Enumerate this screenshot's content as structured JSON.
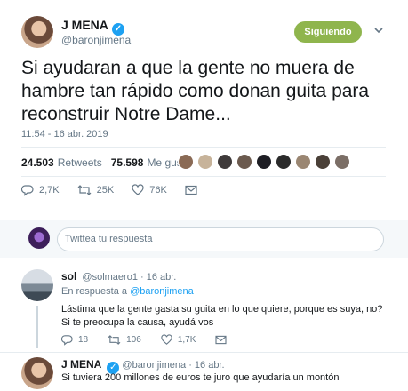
{
  "tweet": {
    "author_name": "J MENA",
    "author_handle": "@baronjimena",
    "follow_label": "Siguiendo",
    "text": "Si ayudaran a que la gente no muera de hambre tan rápido como donan guita para reconstruir Notre Dame...",
    "timestamp": "11:54 - 16 abr. 2019",
    "retweets_count": "24.503",
    "retweets_label": "Retweets",
    "likes_count": "75.598",
    "likes_label": "Me gusta",
    "reply_count": "2,7K",
    "retweet_action_count": "25K",
    "like_action_count": "76K"
  },
  "reply_box": {
    "placeholder": "Twittea tu respuesta"
  },
  "replies": [
    {
      "author_name": "sol",
      "author_handle": "@solmaero1",
      "date": "· 16 abr.",
      "in_reply_prefix": "En respuesta a",
      "in_reply_handle": "@baronjimena",
      "text": "Lástima que la gente gasta su guita en lo que quiere, porque es suya, no? Si te preocupa la causa, ayudá vos",
      "reply_count": "18",
      "retweet_count": "106",
      "like_count": "1,7K"
    },
    {
      "author_name": "J MENA",
      "author_handle": "@baronjimena",
      "date": "· 16 abr.",
      "text": "Si tuviera 200 millones de euros te juro que ayudaría un montón"
    }
  ],
  "colors": {
    "accent": "#1da1f2",
    "follow_button": "#8fb54d",
    "muted": "#657786"
  }
}
